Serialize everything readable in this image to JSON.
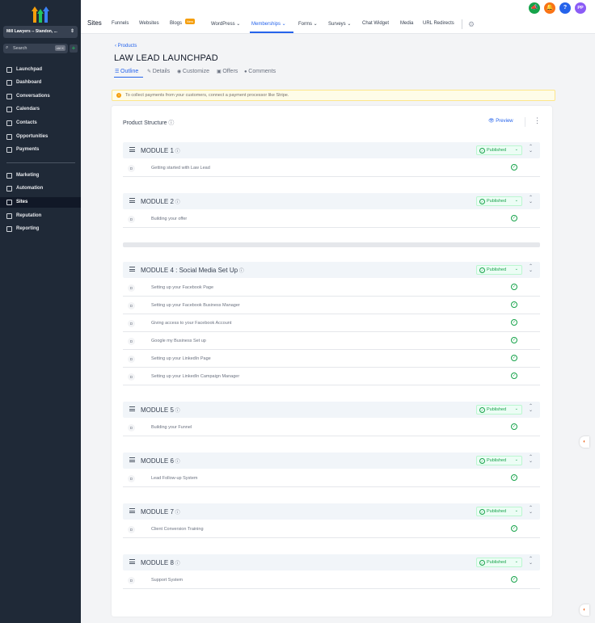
{
  "sidebar": {
    "account": "Mill Lawyers -- Standon, ...",
    "search": {
      "placeholder": "Search",
      "shortcut": "ctrl K"
    },
    "items": [
      {
        "label": "Launchpad",
        "active": false
      },
      {
        "label": "Dashboard",
        "active": false
      },
      {
        "label": "Conversations",
        "active": false
      },
      {
        "label": "Calendars",
        "active": false
      },
      {
        "label": "Contacts",
        "active": false
      },
      {
        "label": "Opportunities",
        "active": false
      },
      {
        "label": "Payments",
        "active": false
      },
      {
        "label": "Marketing",
        "active": false
      },
      {
        "label": "Automation",
        "active": false
      },
      {
        "label": "Sites",
        "active": true
      },
      {
        "label": "Reputation",
        "active": false
      },
      {
        "label": "Reporting",
        "active": false
      }
    ]
  },
  "topbar": {
    "section": "Sites",
    "nav": [
      {
        "label": "Funnels",
        "active": false
      },
      {
        "label": "Websites",
        "active": false
      },
      {
        "label": "Blogs",
        "active": false
      },
      {
        "label": "WordPress ⌄",
        "active": false
      },
      {
        "label": "Memberships ⌄",
        "active": true
      },
      {
        "label": "Forms ⌄",
        "active": false
      },
      {
        "label": "Surveys ⌄",
        "active": false
      },
      {
        "label": "Chat Widget",
        "active": false
      },
      {
        "label": "Media",
        "active": false
      },
      {
        "label": "URL Redirects",
        "active": false
      }
    ],
    "new_badge": "New",
    "avatar_initials": "PP"
  },
  "page": {
    "breadcrumb": "‹ Products",
    "title": "LAW LEAD LAUNCHPAD",
    "tabs": [
      {
        "label": "Outline",
        "active": true
      },
      {
        "label": "Details",
        "active": false
      },
      {
        "label": "Customize",
        "active": false
      },
      {
        "label": "Offers",
        "active": false
      },
      {
        "label": "Comments",
        "active": false
      }
    ],
    "alert": "To collect payments from your customers, connect a payment processor like Stripe.",
    "structure_title": "Product Structure",
    "preview": "Preview"
  },
  "modules": [
    {
      "title": "MODULE 1",
      "status": "Published",
      "lessons": [
        "Getting started with Law Lead"
      ]
    },
    {
      "title": "MODULE 2",
      "status": "Published",
      "lessons": [
        "Building your offer"
      ]
    },
    {
      "title": "MODULE 4 : Social Media Set Up",
      "status": "Published",
      "lessons": [
        "Setting up your Facebook Page",
        "Setting up your Facebook Business Manager",
        "Giving access to your Facebook Account",
        "Google my Business Set up",
        "Setting up your LinkedIn Page",
        "Setting up your LinkedIn Campaign Manager"
      ]
    },
    {
      "title": "MODULE 5",
      "status": "Published",
      "lessons": [
        "Building your Funnel"
      ]
    },
    {
      "title": "MODULE 6",
      "status": "Published",
      "lessons": [
        "Lead Follow-up System"
      ]
    },
    {
      "title": "MODULE 7",
      "status": "Published",
      "lessons": [
        "Client Conversion Training"
      ]
    },
    {
      "title": "MODULE 8",
      "status": "Published",
      "lessons": [
        "Support System"
      ]
    }
  ],
  "lesson_marker": "D",
  "colors": {
    "sidebar": "#1f2937",
    "accent": "#2563eb",
    "published": "#16a34a"
  }
}
